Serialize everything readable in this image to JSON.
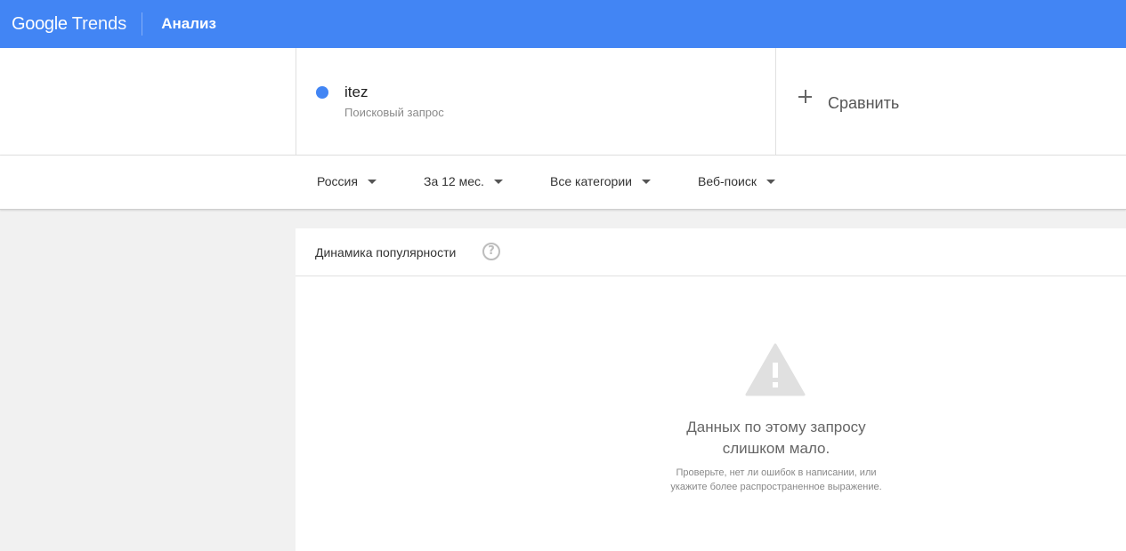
{
  "header": {
    "logo_google": "Google",
    "logo_trends": "Trends",
    "title": "Анализ"
  },
  "search": {
    "term": "itez",
    "term_type": "Поисковый запрос",
    "compare_label": "Сравнить",
    "term_color": "#4285f4"
  },
  "filters": {
    "region": "Россия",
    "period": "За 12 мес.",
    "category": "Все категории",
    "search_type": "Веб-поиск"
  },
  "panel": {
    "title": "Динамика популярности",
    "help_glyph": "?",
    "empty_line1": "Данных по этому запросу",
    "empty_line2": "слишком мало.",
    "hint_line1": "Проверьте, нет ли ошибок в написании, или",
    "hint_line2": "укажите более распространенное выражение."
  },
  "colors": {
    "appbar": "#4285f4",
    "background": "#f1f1f1",
    "warning_icon": "#e0e0e0"
  }
}
